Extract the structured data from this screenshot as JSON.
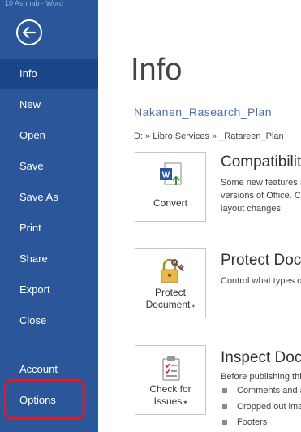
{
  "window": {
    "title_fragment": "10 Ashnab - Word"
  },
  "sidebar": {
    "items": [
      {
        "key": "info",
        "label": "Info",
        "active": true
      },
      {
        "key": "new",
        "label": "New"
      },
      {
        "key": "open",
        "label": "Open"
      },
      {
        "key": "save",
        "label": "Save"
      },
      {
        "key": "save-as",
        "label": "Save As"
      },
      {
        "key": "print",
        "label": "Print"
      },
      {
        "key": "share",
        "label": "Share"
      },
      {
        "key": "export",
        "label": "Export"
      },
      {
        "key": "close",
        "label": "Close"
      },
      {
        "key": "account",
        "label": "Account"
      },
      {
        "key": "options",
        "label": "Options",
        "highlighted": true
      }
    ],
    "highlight_color": "#e0182c"
  },
  "main": {
    "title": "Info",
    "document_name": "Nakanen_Rasearch_Plan",
    "path": "D: » Libro Services » _Ratareen_Plan",
    "sections": [
      {
        "key": "compatibility",
        "button": {
          "label": "Convert",
          "icon": "word-convert-icon"
        },
        "heading": "Compatibility Mode",
        "description": [
          "Some new features are disabled",
          "versions of Office. Converting",
          "layout changes."
        ]
      },
      {
        "key": "protect",
        "button": {
          "label_line1": "Protect",
          "label_line2": "Document",
          "icon": "lock-key-icon",
          "has_dropdown": true
        },
        "heading": "Protect Document",
        "description": [
          "Control what types of changes"
        ]
      },
      {
        "key": "inspect",
        "button": {
          "label_line1": "Check for",
          "label_line2": "Issues",
          "icon": "checklist-icon",
          "has_dropdown": true
        },
        "heading": "Inspect Document",
        "description": [
          "Before publishing this file, be"
        ],
        "bullets": [
          "Comments and annotations",
          "Cropped out image data",
          "Footers"
        ]
      }
    ]
  },
  "colors": {
    "sidebar_bg": "#2b579a",
    "sidebar_active": "#19478a",
    "accent": "#2b579a"
  }
}
